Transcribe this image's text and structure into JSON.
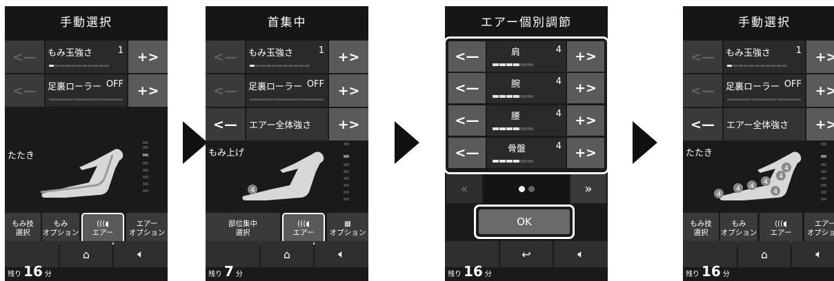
{
  "screens": [
    {
      "title": "手動選択",
      "rows": [
        {
          "label": "もみ玉強さ",
          "value": "1",
          "meter": 1,
          "left_enabled": false
        },
        {
          "label": "足裏ローラー",
          "value": "OFF",
          "meter": 0,
          "left_enabled": false
        }
      ],
      "mode_label": "たたき",
      "menu": [
        "もみ技\n選択",
        "もみ\nオプション",
        "エアー",
        "エアー\nオプション"
      ],
      "remain_label": "残り",
      "remain_value": "16",
      "remain_unit": "分"
    },
    {
      "title": "首集中",
      "rows": [
        {
          "label": "もみ玉強さ",
          "value": "1",
          "meter": 1,
          "left_enabled": false
        },
        {
          "label": "足裏ローラー",
          "value": "OFF",
          "meter": 0,
          "left_enabled": false
        },
        {
          "label": "エアー全体強さ",
          "value": "",
          "meter": 0,
          "left_enabled": true
        }
      ],
      "mode_label": "もみ上げ",
      "menu": [
        "部位集中\n選択",
        "エアー",
        "オプション"
      ],
      "remain_label": "残り",
      "remain_value": "7",
      "remain_unit": "分"
    },
    {
      "title": "エアー個別調節",
      "air_rows": [
        {
          "label": "肩",
          "value": "4",
          "meter": 4
        },
        {
          "label": "腕",
          "value": "4",
          "meter": 4
        },
        {
          "label": "腰",
          "value": "4",
          "meter": 4
        },
        {
          "label": "骨盤",
          "value": "4",
          "meter": 4
        }
      ],
      "page_left": "«",
      "page_right": "»",
      "ok_label": "OK",
      "remain_label": "残り",
      "remain_value": "16",
      "remain_unit": "分"
    },
    {
      "title": "手動選択",
      "rows": [
        {
          "label": "もみ玉強さ",
          "value": "1",
          "meter": 1,
          "left_enabled": false
        },
        {
          "label": "足裏ローラー",
          "value": "OFF",
          "meter": 0,
          "left_enabled": false
        },
        {
          "label": "エアー全体強さ",
          "value": "",
          "meter": 0,
          "left_enabled": true
        }
      ],
      "mode_label": "たたき",
      "menu": [
        "もみ技\n選択",
        "もみ\nオプション",
        "エアー",
        "エアー\nオプション"
      ],
      "remain_label": "残り",
      "remain_value": "16",
      "remain_unit": "分"
    }
  ],
  "symbols": {
    "minus": "<—",
    "plus": "+>",
    "left_dim": "<—",
    "chair_badge": "4"
  },
  "colors": {
    "screen_bg": "#1a1a1a",
    "button": "#5a5a5a",
    "highlight": "#ffffff"
  }
}
